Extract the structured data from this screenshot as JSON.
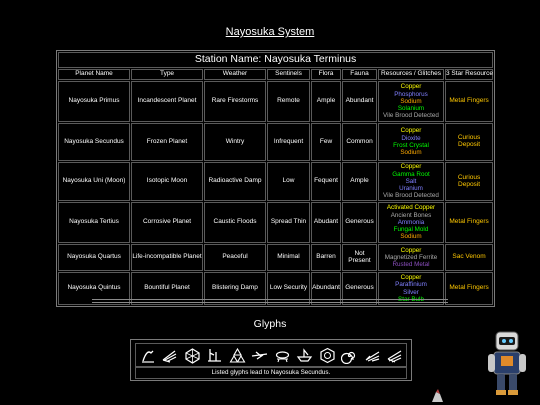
{
  "system": {
    "title": "Nayosuka System"
  },
  "station": {
    "name": "Station Name: Nayosuka Terminus"
  },
  "columns": [
    "Planet Name",
    "Type",
    "Weather",
    "Sentinels",
    "Flora",
    "Fauna",
    "Resources / Glitches",
    "3 Star Resource"
  ],
  "planets": [
    {
      "name": "Nayosuka Primus",
      "type": "Incandescent Planet",
      "weather": "Rare Firestorms",
      "sentinels": "Remote",
      "flora": "Ample",
      "fauna": "Abundant",
      "resources": [
        {
          "text": "Copper",
          "color": "yellow"
        },
        {
          "text": "Phosphorus",
          "color": "blue"
        },
        {
          "text": "Sodium",
          "color": "orange"
        },
        {
          "text": "Solanium",
          "color": "green"
        },
        {
          "text": "Vile Brood Detected",
          "color": "gray"
        }
      ],
      "three_star": "Metal Fingers"
    },
    {
      "name": "Nayosuka Secundus",
      "type": "Frozen Planet",
      "weather": "Wintry",
      "sentinels": "Infrequent",
      "flora": "Few",
      "fauna": "Common",
      "resources": [
        {
          "text": "Copper",
          "color": "yellow"
        },
        {
          "text": "Dioxite",
          "color": "blue"
        },
        {
          "text": "Frost Crystal",
          "color": "green"
        },
        {
          "text": "Sodium",
          "color": "orange"
        }
      ],
      "three_star": "Curious Deposit"
    },
    {
      "name": "Nayosuka Uni (Moon)",
      "type": "Isotopic Moon",
      "weather": "Radioactive Damp",
      "sentinels": "Low",
      "flora": "Fequent",
      "fauna": "Ample",
      "resources": [
        {
          "text": "Copper",
          "color": "yellow"
        },
        {
          "text": "Gamma Root",
          "color": "green"
        },
        {
          "text": "Salt",
          "color": "blue"
        },
        {
          "text": "Uranium",
          "color": "blue"
        },
        {
          "text": "Vile Brood Detected",
          "color": "gray"
        }
      ],
      "three_star": "Curious Deposit"
    },
    {
      "name": "Nayosuka Tertius",
      "type": "Corrosive Planet",
      "weather": "Caustic Floods",
      "sentinels": "Spread Thin",
      "flora": "Abudant",
      "fauna": "Generous",
      "resources": [
        {
          "text": "Activated Copper",
          "color": "yellow"
        },
        {
          "text": "Ancient Bones",
          "color": "gray"
        },
        {
          "text": "Ammonia",
          "color": "blue"
        },
        {
          "text": "Fungal Mold",
          "color": "green"
        },
        {
          "text": "Sodium",
          "color": "orange"
        }
      ],
      "three_star": "Metal Fingers"
    },
    {
      "name": "Nayosuka Quartus",
      "type": "Life-incompatible Planet",
      "weather": "Peaceful",
      "sentinels": "Minimal",
      "flora": "Barren",
      "fauna": "Not Present",
      "resources": [
        {
          "text": "Copper",
          "color": "yellow"
        },
        {
          "text": "Magnetized Ferrite",
          "color": "gray"
        },
        {
          "text": "Rusted Metal",
          "color": "purple"
        }
      ],
      "three_star": "Sac Venom"
    },
    {
      "name": "Nayosuka Quintus",
      "type": "Bountiful Planet",
      "weather": "Blistering Damp",
      "sentinels": "Low Security",
      "flora": "Abundant",
      "fauna": "Generous",
      "resources": [
        {
          "text": "Copper",
          "color": "yellow"
        },
        {
          "text": "Paraffinium",
          "color": "blue"
        },
        {
          "text": "Silver",
          "color": "blue"
        },
        {
          "text": "Star Bulb",
          "color": "green"
        }
      ],
      "three_star": "Metal Fingers"
    }
  ],
  "glyphs": {
    "title": "Glyphs",
    "icons": [
      "sun-glyph-icon",
      "bird-glyph-icon",
      "face-glyph-icon",
      "sail-glyph-icon",
      "triangles-glyph-icon",
      "dragonfly-glyph-icon",
      "voyager-glyph-icon",
      "boat-glyph-icon",
      "bug-glyph-icon",
      "spiral-glyph-icon",
      "whale-glyph-icon",
      "feather-glyph-icon"
    ],
    "caption": "Listed glyphs lead to Nayosuka Secundus."
  },
  "colors": {
    "background": "#000000",
    "yellow": "#ffff00",
    "blue": "#8080ff",
    "green": "#00ff00",
    "orange": "#ffaa00",
    "gray": "#aaaaaa",
    "purple": "#8b4fbf",
    "gold": "#ffc800"
  }
}
